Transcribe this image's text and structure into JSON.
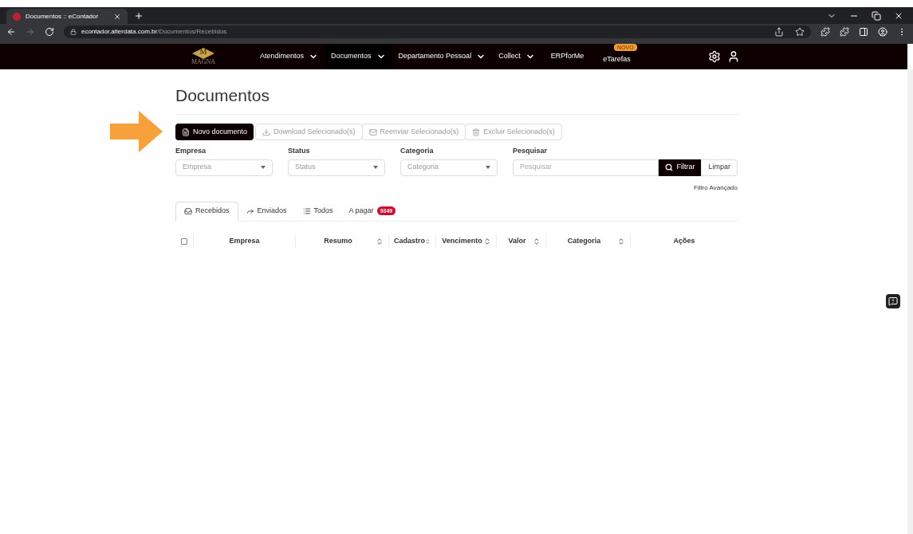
{
  "browser": {
    "tab_title": "Documentos :: eContador",
    "url_host": "econtador.alterdata.com.br",
    "url_path": "/Documentos/Recebidos"
  },
  "navbar": {
    "logo": {
      "letter": "M",
      "name": "MAGNA"
    },
    "items": [
      {
        "label": "Atendimentos",
        "dropdown": true,
        "selected": false
      },
      {
        "label": "Documentos",
        "dropdown": true,
        "selected": true
      },
      {
        "label": "Departamento Pessoal",
        "dropdown": true,
        "selected": false
      },
      {
        "label": "Collect",
        "dropdown": true,
        "selected": false
      },
      {
        "label": "ERPforMe",
        "dropdown": false,
        "selected": false
      },
      {
        "label": "eTarefas",
        "dropdown": false,
        "selected": false,
        "badge": "NOVO"
      }
    ]
  },
  "page_title": "Documentos",
  "toolbar": [
    {
      "label": "Novo documento",
      "kind": "primary"
    },
    {
      "label": "Download Selecionado(s)",
      "kind": "secondary"
    },
    {
      "label": "Reenviar Selecionado(s)",
      "kind": "secondary"
    },
    {
      "label": "Excluir Selecionado(s)",
      "kind": "secondary"
    }
  ],
  "filters": [
    {
      "label": "Empresa",
      "placeholder": "Empresa"
    },
    {
      "label": "Status",
      "placeholder": "Status"
    },
    {
      "label": "Categoria",
      "placeholder": "Categoria"
    }
  ],
  "search": {
    "label": "Pesquisar",
    "placeholder": "Pesquisar",
    "filter_button": "Filtrar",
    "clear_button": "Limpar"
  },
  "advanced_filter": "Filtro Avançado",
  "tabs": [
    {
      "label": "Recebidos",
      "selected": true
    },
    {
      "label": "Enviados",
      "selected": false
    },
    {
      "label": "Todos",
      "selected": false
    },
    {
      "label": "A pagar",
      "badge": "9349",
      "selected": false
    }
  ],
  "table": {
    "select_all": {
      "checked": false
    },
    "columns": [
      {
        "label": "Empresa",
        "sortable": false
      },
      {
        "label": "Resumo",
        "sortable": true
      },
      {
        "label": "Cadastro",
        "sortable": true
      },
      {
        "label": "Vencimento",
        "sortable": true
      },
      {
        "label": "Valor",
        "sortable": true
      },
      {
        "label": "Categoria",
        "sortable": true
      },
      {
        "label": "Ações",
        "sortable": false
      }
    ]
  }
}
